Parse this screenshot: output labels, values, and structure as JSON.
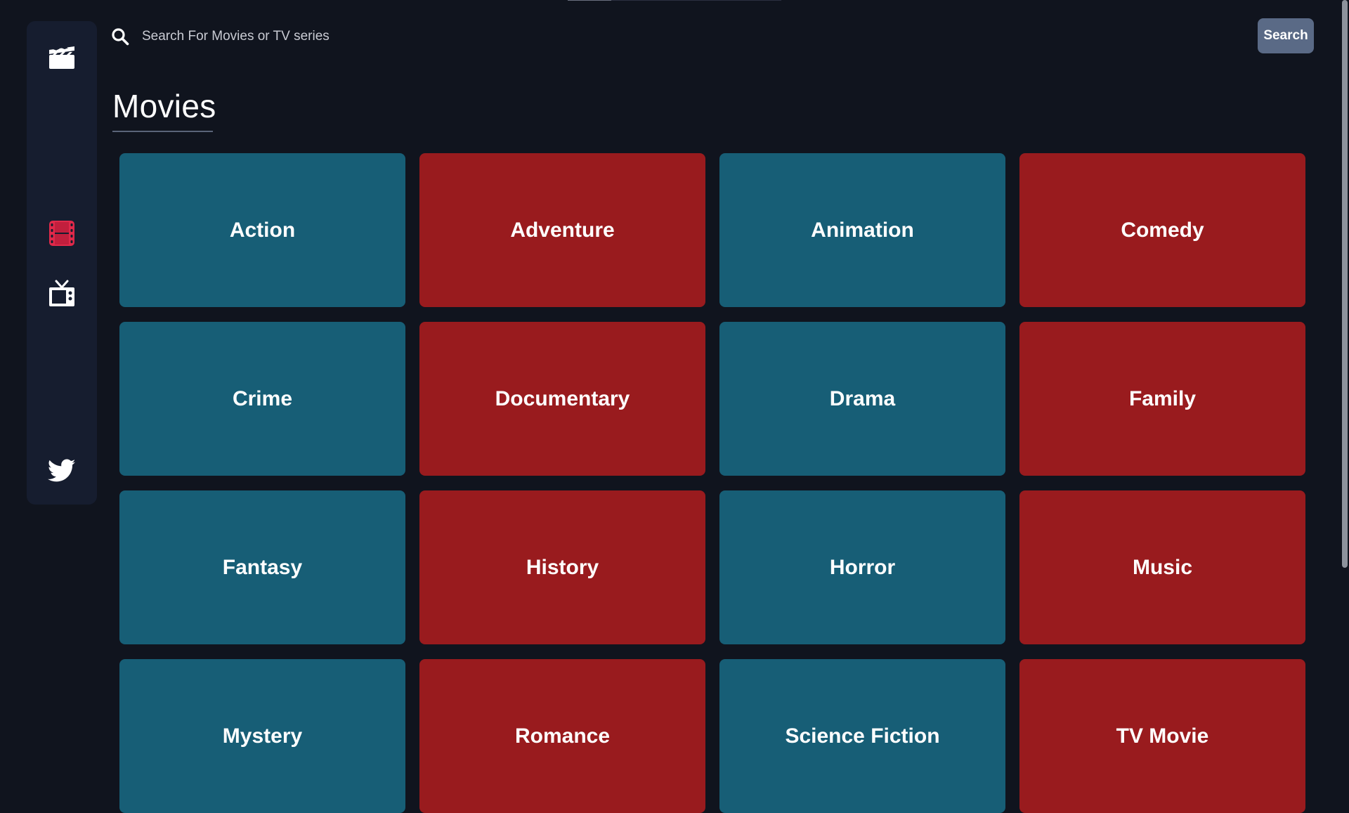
{
  "search": {
    "placeholder": "Search For Movies or TV series",
    "button_label": "Search"
  },
  "sidebar": {
    "items": [
      {
        "icon": "clapperboard-icon",
        "name": "logo"
      },
      {
        "icon": "film-icon",
        "name": "movies",
        "active": true
      },
      {
        "icon": "tv-icon",
        "name": "tv-series"
      },
      {
        "icon": "twitter-icon",
        "name": "twitter"
      }
    ]
  },
  "page": {
    "title": "Movies"
  },
  "genres": [
    {
      "label": "Action",
      "color": "#175e76"
    },
    {
      "label": "Adventure",
      "color": "#991b1e"
    },
    {
      "label": "Animation",
      "color": "#175e76"
    },
    {
      "label": "Comedy",
      "color": "#991b1e"
    },
    {
      "label": "Crime",
      "color": "#175e76"
    },
    {
      "label": "Documentary",
      "color": "#991b1e"
    },
    {
      "label": "Drama",
      "color": "#175e76"
    },
    {
      "label": "Family",
      "color": "#991b1e"
    },
    {
      "label": "Fantasy",
      "color": "#175e76"
    },
    {
      "label": "History",
      "color": "#991b1e"
    },
    {
      "label": "Horror",
      "color": "#175e76"
    },
    {
      "label": "Music",
      "color": "#991b1e"
    },
    {
      "label": "Mystery",
      "color": "#175e76"
    },
    {
      "label": "Romance",
      "color": "#991b1e"
    },
    {
      "label": "Science Fiction",
      "color": "#175e76"
    },
    {
      "label": "TV Movie",
      "color": "#991b1e"
    }
  ],
  "colors": {
    "background": "#10141e",
    "sidebar": "#161d2f",
    "accent_active": "#e0294a",
    "teal_card": "#175e76",
    "red_card": "#991b1e",
    "search_button": "#5a6a86"
  }
}
